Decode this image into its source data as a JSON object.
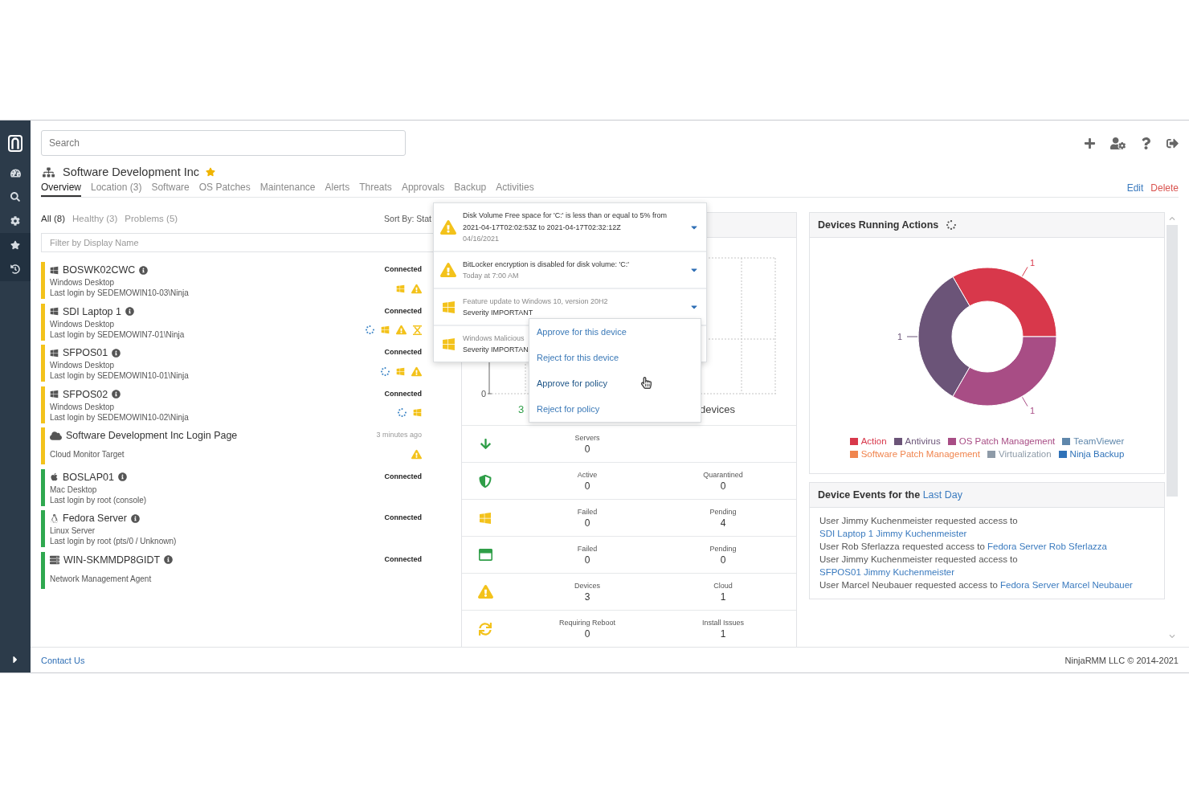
{
  "search": {
    "placeholder": "Search"
  },
  "organization": {
    "name": "Software Development Inc",
    "favorite": true
  },
  "tabs": [
    {
      "label": "Overview",
      "selected": true
    },
    {
      "label": "Location (3)",
      "selected": false
    },
    {
      "label": "Software",
      "selected": false
    },
    {
      "label": "OS Patches",
      "selected": false
    },
    {
      "label": "Maintenance",
      "selected": false
    },
    {
      "label": "Alerts",
      "selected": false
    },
    {
      "label": "Threats",
      "selected": false
    },
    {
      "label": "Approvals",
      "selected": false
    },
    {
      "label": "Backup",
      "selected": false
    },
    {
      "label": "Activities",
      "selected": false
    }
  ],
  "page_actions": {
    "edit": "Edit",
    "delete": "Delete"
  },
  "device_list": {
    "filters": [
      {
        "label": "All (8)",
        "selected": true
      },
      {
        "label": "Healthy (3)",
        "selected": false
      },
      {
        "label": "Problems (5)",
        "selected": false
      }
    ],
    "sort": "Sort By: Stat",
    "filter": {
      "placeholder": "Filter by Display Name"
    },
    "devices": [
      {
        "kind": "windows",
        "name": "BOSWK02CWC",
        "info": true,
        "color": "#f3c21b",
        "lines": [
          "Windows Desktop",
          "Last login by SEDEMOWIN10-03\\Ninja"
        ],
        "status": "Connected",
        "indicators": [
          {
            "kind": "patch"
          },
          {
            "kind": "alert"
          }
        ]
      },
      {
        "kind": "windows",
        "name": "SDI Laptop 1",
        "info": true,
        "color": "#f3c21b",
        "lines": [
          "Windows Desktop",
          "Last login by SEDEMOWIN7-01\\Ninja"
        ],
        "status": "Connected",
        "indicators": [
          {
            "kind": "running"
          },
          {
            "kind": "patch"
          },
          {
            "kind": "alert"
          },
          {
            "kind": "pending"
          }
        ]
      },
      {
        "kind": "windows",
        "name": "SFPOS01",
        "info": true,
        "color": "#f3c21b",
        "lines": [
          "Windows Desktop",
          "Last login by SEDEMOWIN10-01\\Ninja"
        ],
        "status": "Connected",
        "indicators": [
          {
            "kind": "running"
          },
          {
            "kind": "patch"
          },
          {
            "kind": "alert"
          }
        ]
      },
      {
        "kind": "windows",
        "name": "SFPOS02",
        "info": true,
        "color": "#f3c21b",
        "lines": [
          "Windows Desktop",
          "Last login by SEDEMOWIN10-02\\Ninja"
        ],
        "status": "Connected",
        "indicators": [
          {
            "kind": "running"
          },
          {
            "kind": "patch"
          }
        ]
      },
      {
        "kind": "cloud",
        "name": "Software Development Inc Login Page",
        "info": false,
        "color": "#f3c21b",
        "lines": [
          "Cloud Monitor Target"
        ],
        "status": "3 minutes ago",
        "indicators": [
          {
            "kind": "alert"
          }
        ]
      },
      {
        "kind": "mac",
        "name": "BOSLAP01",
        "info": true,
        "color": "#2fa84f",
        "lines": [
          "Mac Desktop",
          "Last login by root (console)"
        ],
        "status": "Connected"
      },
      {
        "kind": "linux",
        "name": "Fedora Server",
        "info": true,
        "color": "#2fa84f",
        "lines": [
          "Linux Server",
          "Last login by root (pts/0 / Unknown)"
        ],
        "status": "Connected"
      },
      {
        "kind": "server",
        "name": "WIN-SKMMDP8GIDT",
        "info": true,
        "color": "#2fa84f",
        "lines": [
          "Network Management Agent"
        ],
        "status": "Connected"
      }
    ]
  },
  "alerts_popover": {
    "items": [
      {
        "kind": "alert",
        "title": "Disk Volume Free space for 'C:' is less than or equal to 5% from 2021-04-17T02:02:53Z to 2021-04-17T02:32:12Z",
        "detail": "04/16/2021",
        "expanded": false
      },
      {
        "kind": "alert",
        "title": "BitLocker encryption is disabled for disk volume: 'C:'",
        "detail": "Today at 7:00 AM",
        "expanded": false
      },
      {
        "kind": "patch",
        "title": "Feature update to Windows 10, version 20H2",
        "detail": "Severity IMPORTANT",
        "expanded": true,
        "menu": [
          {
            "label": "Approve for this device",
            "hovered": false
          },
          {
            "label": "Reject for this device",
            "hovered": false
          },
          {
            "label": "Approve for policy",
            "hovered": true
          },
          {
            "label": "Reject for policy",
            "hovered": false
          }
        ]
      },
      {
        "kind": "patch",
        "title": "Windows Malicious",
        "detail": "Severity IMPORTAN",
        "expanded": false
      }
    ]
  },
  "summary_panel": {
    "chart": {
      "y_tick": "0",
      "count": "3",
      "unit": "devices"
    },
    "rows": [
      {
        "kind": "backup",
        "cells": [
          {
            "label": "Servers",
            "value": "0"
          }
        ]
      },
      {
        "kind": "antivirus",
        "cells": [
          {
            "label": "Active",
            "value": "0"
          },
          {
            "label": "Quarantined",
            "value": "0"
          }
        ]
      },
      {
        "kind": "os_patch",
        "cells": [
          {
            "label": "Failed",
            "value": "0"
          },
          {
            "label": "Pending",
            "value": "4"
          }
        ]
      },
      {
        "kind": "software_patch",
        "cells": [
          {
            "label": "Failed",
            "value": "0"
          },
          {
            "label": "Pending",
            "value": "0"
          }
        ]
      },
      {
        "kind": "alert",
        "cells": [
          {
            "label": "Devices",
            "value": "3"
          },
          {
            "label": "Cloud",
            "value": "1"
          }
        ]
      },
      {
        "kind": "reboot",
        "cells": [
          {
            "label": "Requiring Reboot",
            "value": "0"
          },
          {
            "label": "Install Issues",
            "value": "1"
          }
        ]
      }
    ]
  },
  "actions_panel": {
    "title": "Devices Running Actions",
    "running": true,
    "chart_data": {
      "type": "donut",
      "categories": [
        "Action",
        "Antivirus",
        "OS Patch Management",
        "TeamViewer",
        "Software Patch Management",
        "Virtualization",
        "Ninja Backup"
      ],
      "values": [
        1,
        1,
        1,
        0,
        0,
        0,
        0
      ],
      "colors": [
        "#d8384b",
        "#6b5478",
        "#a84d85",
        "#5f87ab",
        "#f0854f",
        "#8e9ba8",
        "#2f72b8"
      ],
      "data_labels": true
    }
  },
  "events_panel": {
    "title": "Device Events for the",
    "period": "Last Day",
    "events": [
      {
        "text": "User Jimmy Kuchenmeister requested access to",
        "link": "SDI Laptop 1 Jimmy Kuchenmeister"
      },
      {
        "text": "User Rob Sferlazza requested access to",
        "link": "Fedora Server Rob Sferlazza"
      },
      {
        "text": "User Jimmy Kuchenmeister requested access to",
        "link": "SFPOS01 Jimmy Kuchenmeister"
      },
      {
        "text": "User Marcel Neubauer requested access to",
        "link": "Fedora Server Marcel Neubauer"
      }
    ]
  },
  "footer": {
    "contact": "Contact Us",
    "copyright": "NinjaRMM LLC © 2014-2021"
  }
}
